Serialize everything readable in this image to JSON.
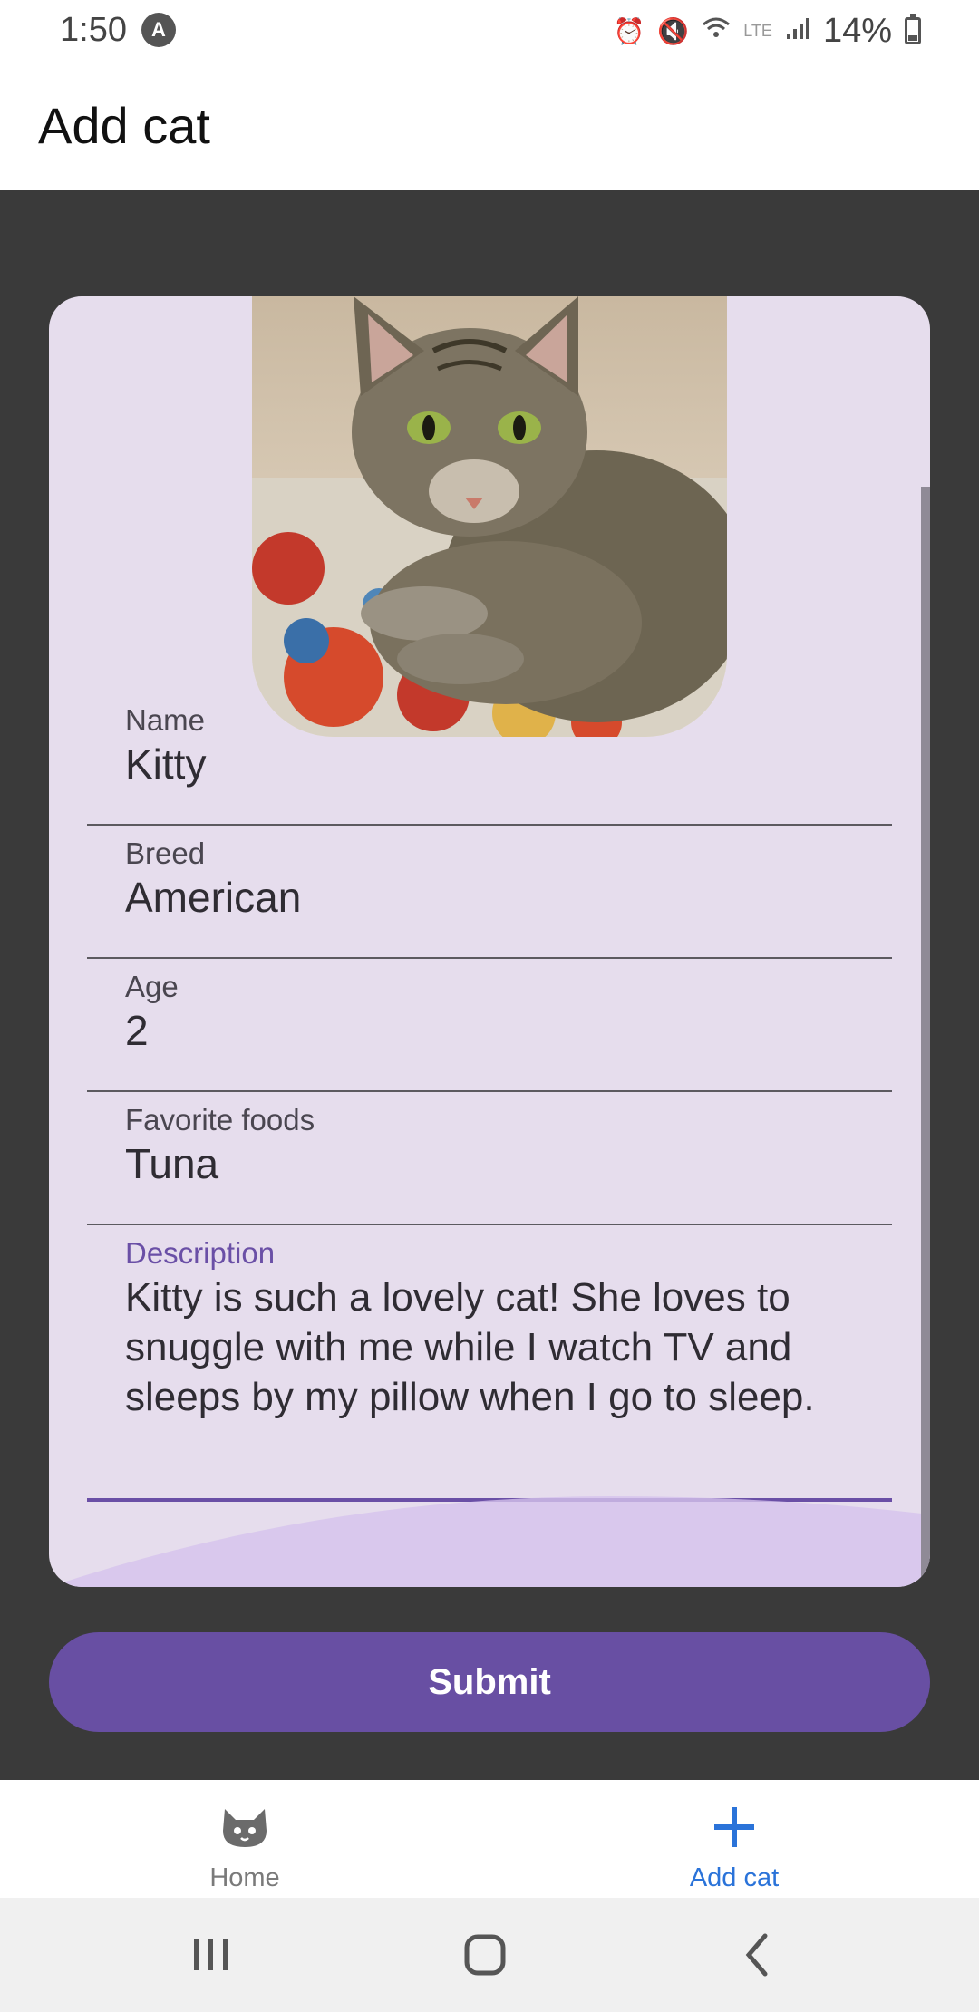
{
  "status_bar": {
    "time": "1:50",
    "app_icon": "A",
    "battery": "14%",
    "icons": [
      "alarm-icon",
      "mute-icon",
      "wifi-icon",
      "lte-icon",
      "signal-icon",
      "battery-icon"
    ]
  },
  "app_bar": {
    "title": "Add cat"
  },
  "form": {
    "photo": {
      "alt": "cat-photo"
    },
    "fields": [
      {
        "label": "Name",
        "value": "Kitty"
      },
      {
        "label": "Breed",
        "value": "American"
      },
      {
        "label": "Age",
        "value": "2"
      },
      {
        "label": "Favorite foods",
        "value": "Tuna"
      },
      {
        "label": "Description",
        "value": "Kitty is such a lovely cat! She loves to snuggle with me while I watch TV and sleeps by my pillow when I go to sleep."
      }
    ]
  },
  "submit_label": "Submit",
  "bottom_nav": {
    "items": [
      {
        "label": "Home",
        "icon": "cat-icon",
        "active": false
      },
      {
        "label": "Add cat",
        "icon": "plus-icon",
        "active": true
      }
    ]
  },
  "colors": {
    "primary": "#684fa3",
    "card_bg": "#e6dded",
    "screen_bg": "#3a3a3a",
    "nav_active": "#2a73d9"
  }
}
